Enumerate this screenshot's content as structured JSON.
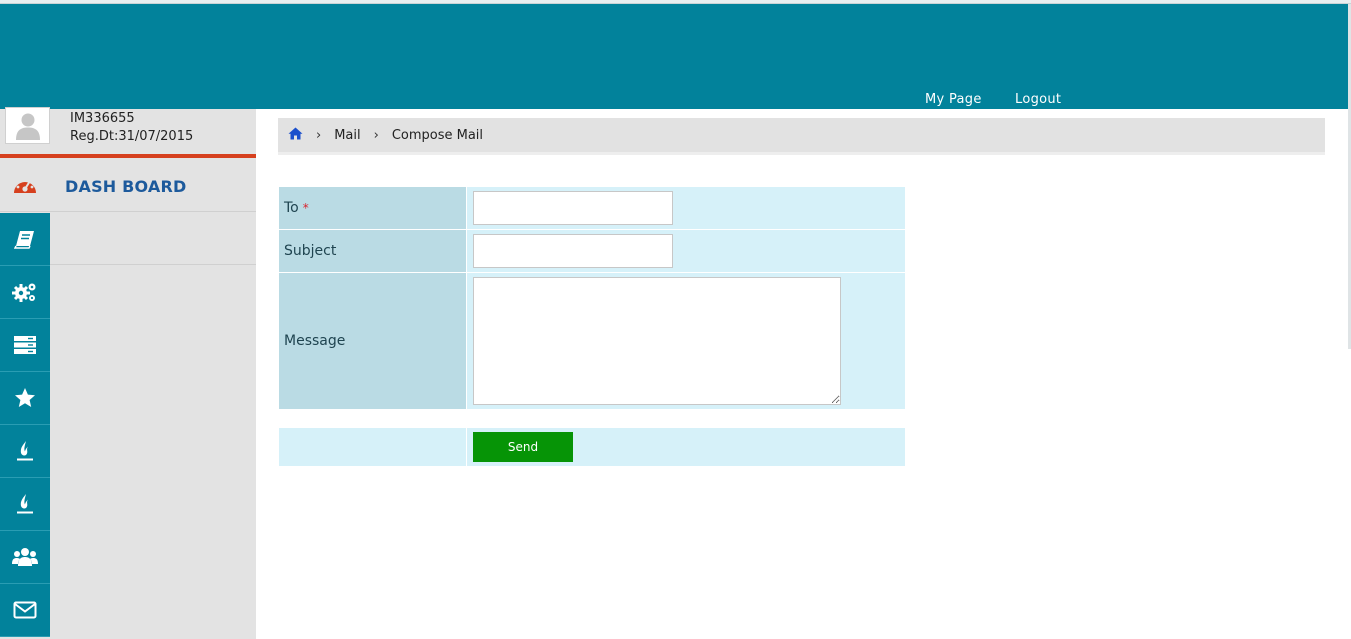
{
  "header": {
    "nav": [
      "My Page",
      "Logout"
    ]
  },
  "profile": {
    "user_id": "IM336655",
    "reg_date": "Reg.Dt:31/07/2015"
  },
  "sidebar": {
    "dashboard_label": "DASH BOARD",
    "icons": [
      "book-icon",
      "cogs-icon",
      "server-icon",
      "star-icon",
      "fire-icon",
      "fire-icon",
      "users-icon",
      "mail-icon"
    ]
  },
  "breadcrumb": {
    "home_icon": "home-icon",
    "items": [
      "Mail",
      "Compose Mail"
    ],
    "separator": "›"
  },
  "form": {
    "to_label": "To",
    "required_mark": "*",
    "subject_label": "Subject",
    "message_label": "Message",
    "to_value": "",
    "subject_value": "",
    "message_value": "",
    "send_label": "Send"
  },
  "colors": {
    "header": "#02829b",
    "accent_red": "#d6401e",
    "dashboard_text": "#1d5a9c",
    "label_bg": "#badbe4",
    "field_bg": "#d6f1f9",
    "send_button": "#069406"
  }
}
